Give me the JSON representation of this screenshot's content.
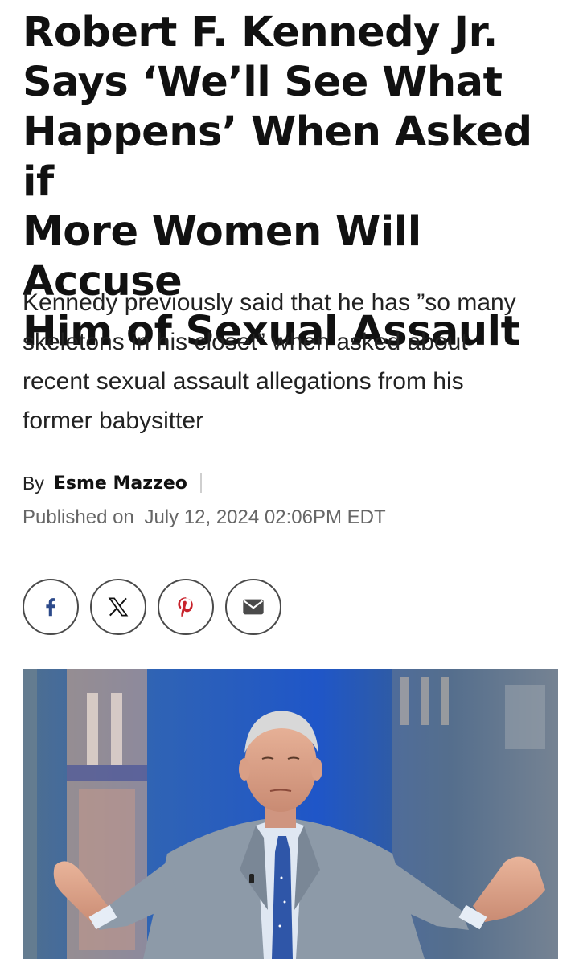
{
  "article": {
    "headline": "Robert F. Kennedy Jr. Says ‘We’ll See What Happens’ When Asked if More Women Will Accuse Him of Sexual Assault",
    "headline_lines": [
      "Robert F. Kennedy Jr.",
      "Says ‘We’ll See What",
      "Happens’ When Asked if",
      "More Women Will Accuse",
      "Him of Sexual Assault"
    ],
    "subheadline_lines": [
      "Kennedy previously said that he has ”so many",
      "skeletons in his closet” when asked about",
      "recent sexual assault allegations from his",
      "former babysitter"
    ],
    "byline": {
      "prefix": "By",
      "author": "Esme Mazzeo"
    },
    "published": {
      "label": "Published on",
      "date": "July 12, 2024 02:06PM EDT"
    }
  },
  "share": {
    "buttons": [
      {
        "name": "facebook",
        "icon": "facebook-icon",
        "color": "#2d4a8a"
      },
      {
        "name": "x",
        "icon": "x-icon",
        "color": "#111111"
      },
      {
        "name": "pinterest",
        "icon": "pinterest-icon",
        "color": "#c8232c"
      },
      {
        "name": "email",
        "icon": "mail-icon",
        "color": "#4a4a4a"
      }
    ]
  },
  "colors": {
    "text": "#111111",
    "muted": "#666666",
    "divider": "#cfcfcf"
  }
}
